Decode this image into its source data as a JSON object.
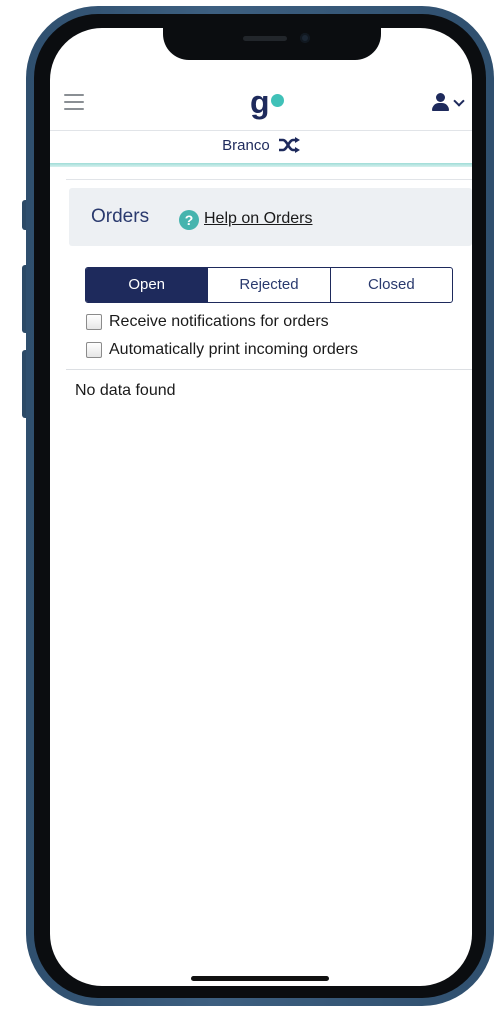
{
  "header": {
    "menu_icon": "hamburger-icon",
    "logo_letter": "g",
    "user_icon": "user-icon",
    "branch_name": "Branco",
    "branch_icon": "shuffle-icon",
    "accent_color": "#40c1b8",
    "brand_color": "#1e2a5c"
  },
  "orders": {
    "title": "Orders",
    "help_icon": "question-circle-icon",
    "help_label": "Help on Orders"
  },
  "tabs": [
    {
      "label": "Open",
      "active": true
    },
    {
      "label": "Rejected",
      "active": false
    },
    {
      "label": "Closed",
      "active": false
    }
  ],
  "options": [
    {
      "label": "Receive notifications for orders",
      "checked": false
    },
    {
      "label": "Automatically print incoming orders",
      "checked": false
    }
  ],
  "empty_message": "No data found"
}
